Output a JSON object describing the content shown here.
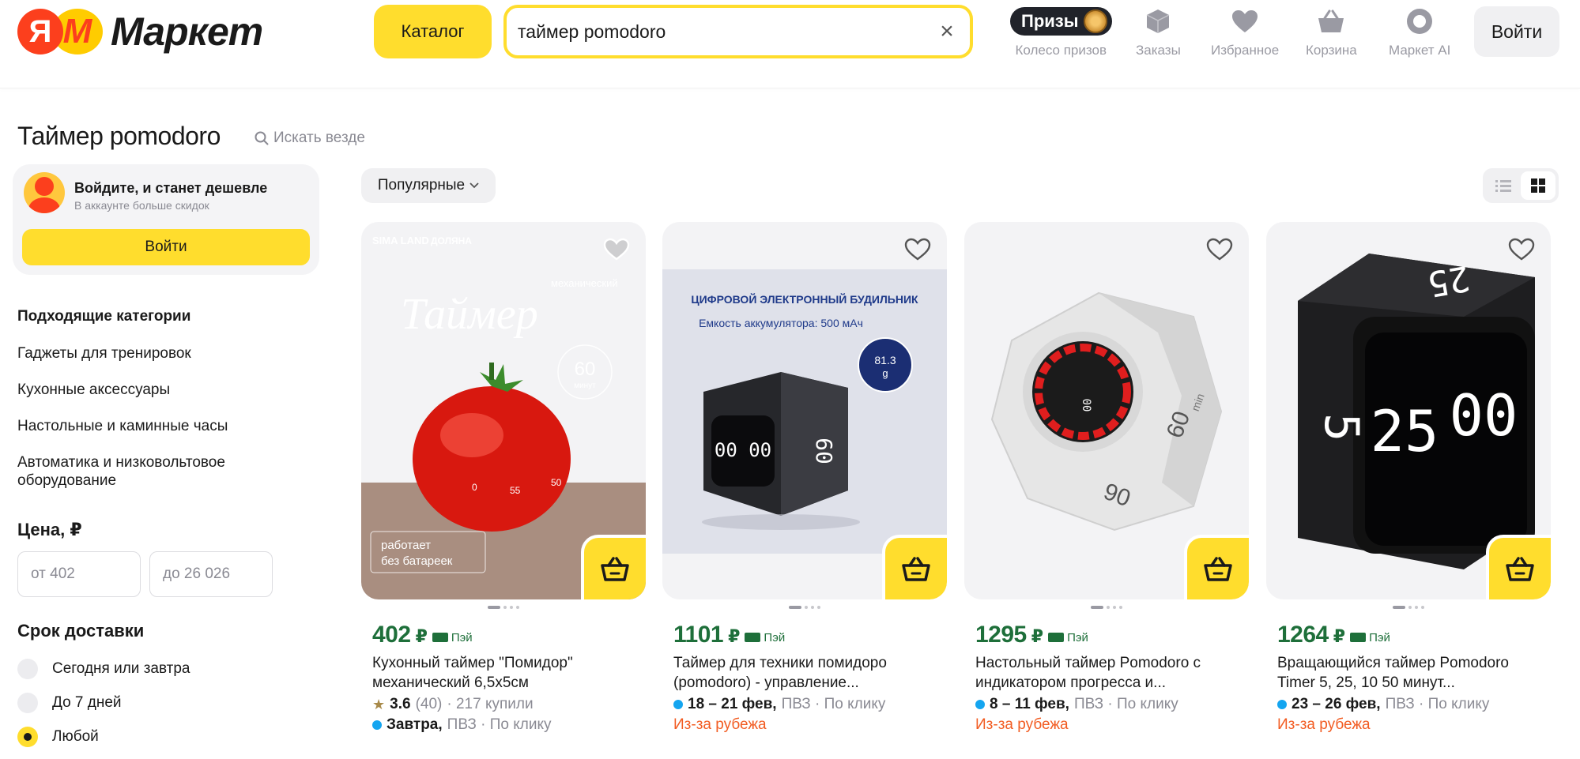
{
  "header": {
    "logo_ya": "Я",
    "logo_m": "М",
    "logo_word": "Маркет",
    "catalog_label": "Каталог",
    "search_value": "таймер pomodoro",
    "prizes_pill": "Призы",
    "items": [
      {
        "label": "Колесо призов"
      },
      {
        "label": "Заказы"
      },
      {
        "label": "Избранное"
      },
      {
        "label": "Корзина"
      },
      {
        "label": "Маркет AI"
      }
    ],
    "login_label": "Войти"
  },
  "page": {
    "title": "Таймер pomodoro",
    "search_everywhere": "Искать везде"
  },
  "sidebar": {
    "promo_title": "Войдите, и станет дешевле",
    "promo_subtitle": "В аккаунте больше скидок",
    "promo_button": "Войти",
    "categories_title": "Подходящие категории",
    "categories": [
      "Гаджеты для тренировок",
      "Кухонные аксессуары",
      "Настольные и каминные часы",
      "Автоматика и низковольтовое оборудование"
    ],
    "price_title": "Цена, ₽",
    "price_from_placeholder": "от 402",
    "price_to_placeholder": "до 26 026",
    "delivery_title": "Срок доставки",
    "delivery_options": [
      {
        "label": "Сегодня или завтра",
        "selected": false
      },
      {
        "label": "До 7 дней",
        "selected": false
      },
      {
        "label": "Любой",
        "selected": true
      }
    ]
  },
  "toolbar": {
    "sort_label": "Популярные"
  },
  "products": [
    {
      "price": "402",
      "currency": "₽",
      "pay": "Пэй",
      "name": "Кухонный таймер \"Помидор\" механический 6,5х5см",
      "rating": "3.6",
      "reviews": "(40)",
      "bought": "· 217 купили",
      "delivery_date": "Завтра,",
      "delivery_rest": "ПВЗ · По клику",
      "origin": "",
      "image_text": {
        "brand1": "SIMA LAND",
        "brand2": "ДОЛЯНА",
        "small": "механический",
        "big": "Таймер",
        "badge_num": "60",
        "badge_unit": "минут",
        "note1": "работает",
        "note2": "без батареек",
        "dial": [
          "0",
          "55",
          "50"
        ]
      }
    },
    {
      "price": "1101",
      "currency": "₽",
      "pay": "Пэй",
      "name": "Таймер для техники помидоро (pomodoro) - управление...",
      "rating": "",
      "reviews": "",
      "bought": "",
      "delivery_date": "18 – 21 фев,",
      "delivery_rest": "ПВЗ · По клику",
      "origin": "Из-за рубежа",
      "image_text": {
        "headline": "ЦИФРОВОЙ ЭЛЕКТРОННЫЙ БУДИЛЬНИК",
        "sub": "Емкость аккумулятора: 500 мАч",
        "weight_num": "81.3",
        "weight_unit": "g",
        "display": "00 00",
        "side": "60"
      }
    },
    {
      "price": "1295",
      "currency": "₽",
      "pay": "Пэй",
      "name": "Настольный таймер Pomodoro с индикатором прогресса и...",
      "rating": "",
      "reviews": "",
      "bought": "",
      "delivery_date": "8 – 11 фев,",
      "delivery_rest": "ПВЗ · По клику",
      "origin": "Из-за рубежа",
      "image_text": {
        "side": "60",
        "bottom": "90",
        "unit": "min"
      }
    },
    {
      "price": "1264",
      "currency": "₽",
      "pay": "Пэй",
      "name": "Вращающийся таймер Pomodoro Timer 5, 25, 10 50 минут...",
      "rating": "",
      "reviews": "",
      "bought": "",
      "delivery_date": "23 – 26 фев,",
      "delivery_rest": "ПВЗ · По клику",
      "origin": "Из-за рубежа",
      "image_text": {
        "display_left": "25",
        "display_right": "00",
        "side": "5",
        "top": "25"
      }
    }
  ],
  "colors": {
    "accent_yellow": "#ffdd2d",
    "price_green": "#1e6f3a",
    "origin_orange": "#f25c22",
    "delivery_dot": "#14a5f0"
  }
}
